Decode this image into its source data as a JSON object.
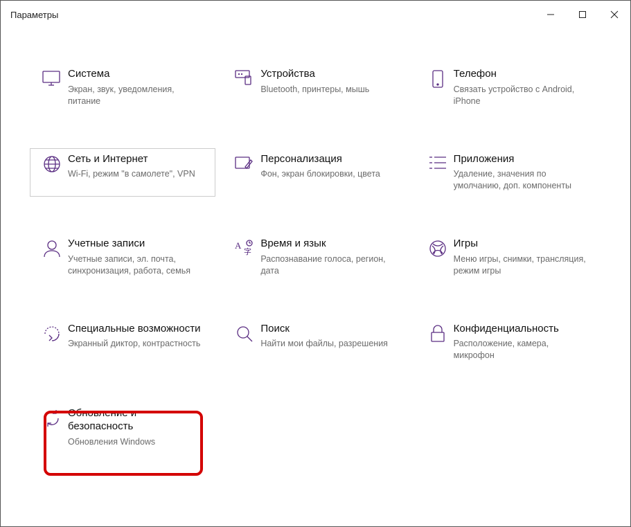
{
  "window": {
    "title": "Параметры"
  },
  "tiles": {
    "system": {
      "title": "Система",
      "sub": "Экран, звук, уведомления, питание"
    },
    "devices": {
      "title": "Устройства",
      "sub": "Bluetooth, принтеры, мышь"
    },
    "phone": {
      "title": "Телефон",
      "sub": "Связать устройство с Android, iPhone"
    },
    "network": {
      "title": "Сеть и Интернет",
      "sub": "Wi-Fi, режим \"в самолете\", VPN"
    },
    "personal": {
      "title": "Персонализация",
      "sub": "Фон, экран блокировки, цвета"
    },
    "apps": {
      "title": "Приложения",
      "sub": "Удаление, значения по умолчанию, доп. компоненты"
    },
    "accounts": {
      "title": "Учетные записи",
      "sub": "Учетные записи, эл. почта, синхронизация, работа, семья"
    },
    "time": {
      "title": "Время и язык",
      "sub": "Распознавание голоса, регион, дата"
    },
    "gaming": {
      "title": "Игры",
      "sub": "Меню игры, снимки, трансляция, режим игры"
    },
    "ease": {
      "title": "Специальные возможности",
      "sub": "Экранный диктор, контрастность"
    },
    "search": {
      "title": "Поиск",
      "sub": "Найти мои файлы, разрешения"
    },
    "privacy": {
      "title": "Конфиденциальность",
      "sub": "Расположение, камера, микрофон"
    },
    "update": {
      "title": "Обновление и безопасность",
      "sub": "Обновления Windows"
    }
  }
}
